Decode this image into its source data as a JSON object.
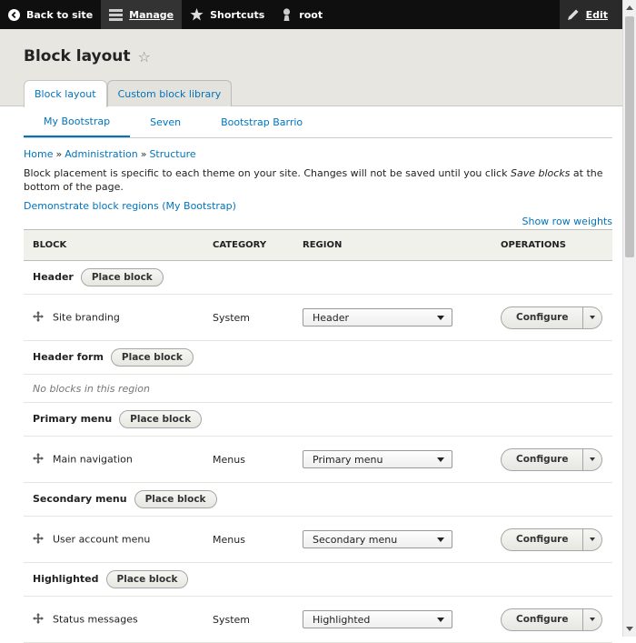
{
  "toolbar": {
    "back_label": "Back to site",
    "manage_label": "Manage",
    "shortcuts_label": "Shortcuts",
    "user_label": "root",
    "edit_label": "Edit"
  },
  "page": {
    "title": "Block layout",
    "star": "☆"
  },
  "primary_tabs": [
    {
      "label": "Block layout",
      "active": true
    },
    {
      "label": "Custom block library",
      "active": false
    }
  ],
  "secondary_tabs": [
    {
      "label": "My Bootstrap",
      "active": true
    },
    {
      "label": "Seven",
      "active": false
    },
    {
      "label": "Bootstrap Barrio",
      "active": false
    }
  ],
  "breadcrumb": {
    "items": [
      "Home",
      "Administration",
      "Structure"
    ],
    "separator": "»"
  },
  "description": {
    "before": "Block placement is specific to each theme on your site. Changes will not be saved until you click ",
    "emphasis": "Save blocks",
    "after": " at the bottom of the page."
  },
  "demo_link": "Demonstrate block regions (My Bootstrap)",
  "row_weights_link": "Show row weights",
  "table": {
    "headers": [
      "BLOCK",
      "CATEGORY",
      "REGION",
      "OPERATIONS"
    ],
    "place_block_label": "Place block",
    "configure_label": "Configure",
    "empty_text": "No blocks in this region",
    "rows": [
      {
        "type": "region",
        "name": "Header"
      },
      {
        "type": "block",
        "name": "Site branding",
        "category": "System",
        "region": "Header"
      },
      {
        "type": "region",
        "name": "Header form"
      },
      {
        "type": "empty"
      },
      {
        "type": "region",
        "name": "Primary menu"
      },
      {
        "type": "block",
        "name": "Main navigation",
        "category": "Menus",
        "region": "Primary menu"
      },
      {
        "type": "region",
        "name": "Secondary menu"
      },
      {
        "type": "block",
        "name": "User account menu",
        "category": "Menus",
        "region": "Secondary menu"
      },
      {
        "type": "region",
        "name": "Highlighted"
      },
      {
        "type": "block",
        "name": "Status messages",
        "category": "System",
        "region": "Highlighted"
      }
    ]
  }
}
